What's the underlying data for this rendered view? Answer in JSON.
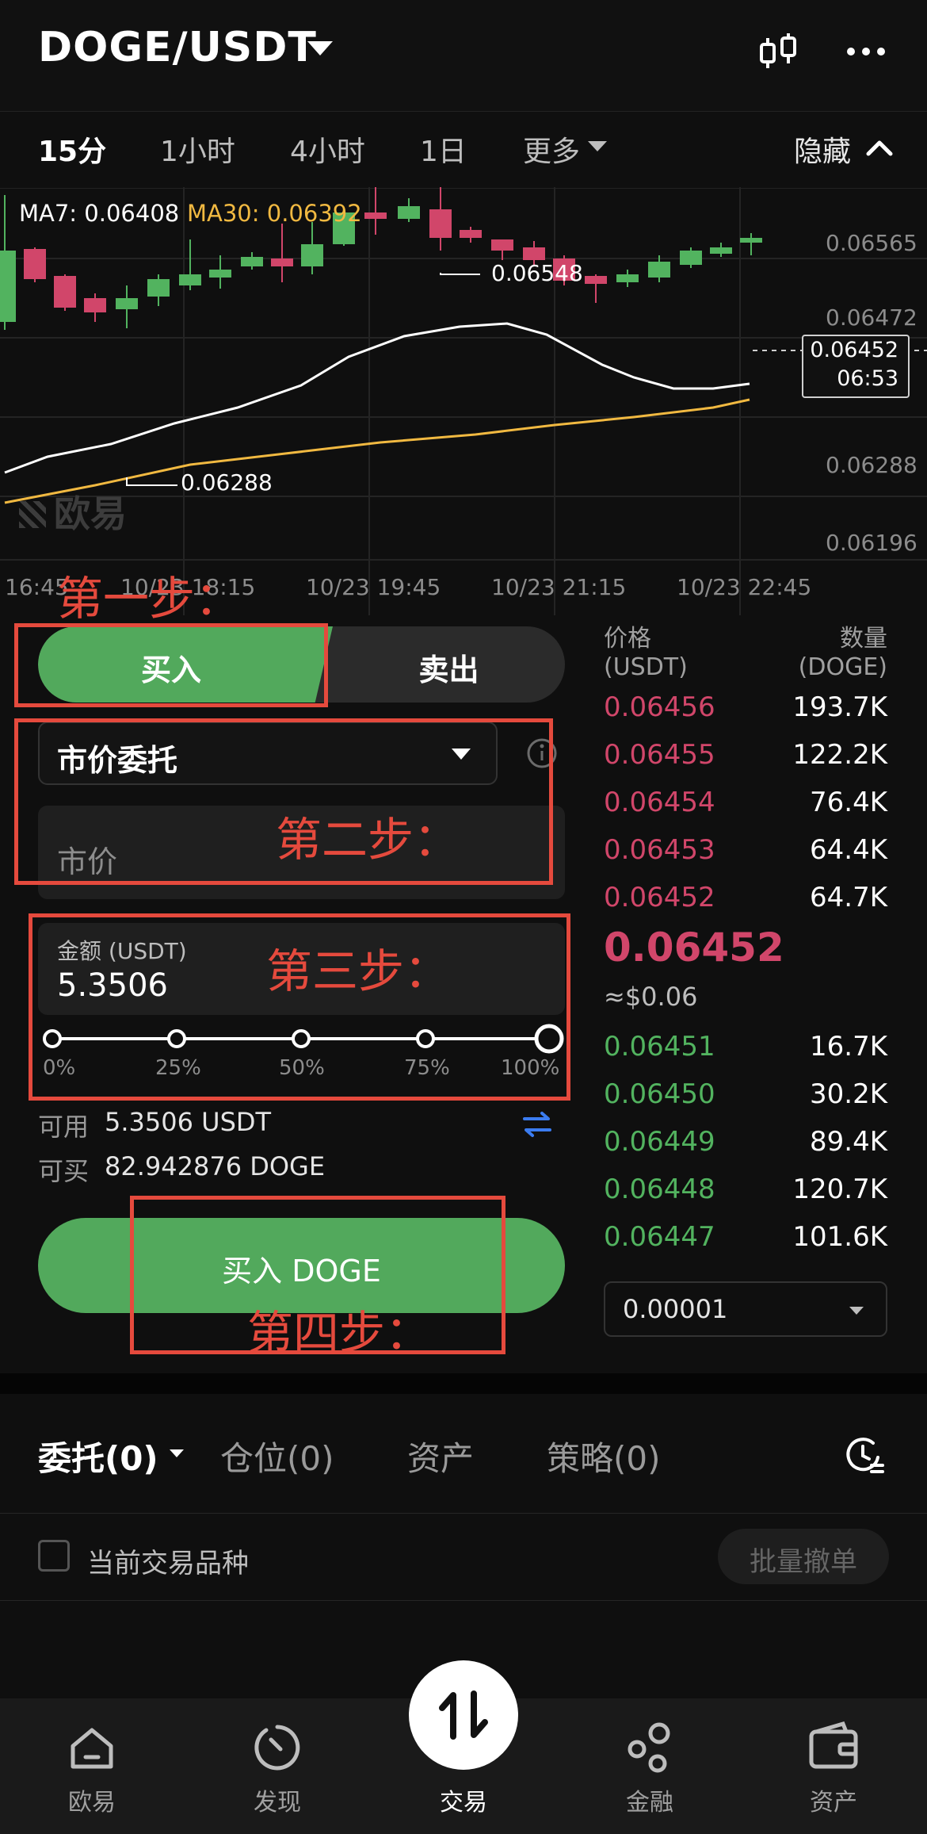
{
  "header": {
    "pair": "DOGE/USDT",
    "icons": [
      "candlestick-icon",
      "more-icon"
    ]
  },
  "timeframes": {
    "items": [
      "15分",
      "1小时",
      "4小时",
      "1日",
      "更多"
    ],
    "active": "15分",
    "hide_label": "隐藏"
  },
  "chart": {
    "ma7": "MA7: 0.06408",
    "ma30": "MA30: 0.06392",
    "y_ticks": [
      "0.06565",
      "0.06472",
      "0.06288",
      "0.06196"
    ],
    "x_ticks": [
      "16:45",
      "10/23 18:15",
      "10/23 19:45",
      "10/23 21:15",
      "10/23 22:45"
    ],
    "high_label": "0.06548",
    "low_label": "0.06288",
    "current_price": "0.06452",
    "countdown": "06:53",
    "watermark": "欧易",
    "colors": {
      "up": "#52b35f",
      "down": "#d1466a",
      "ma7": "#ffffff",
      "ma30": "#f1b941"
    }
  },
  "order_form": {
    "buy_tab": "买入",
    "sell_tab": "卖出",
    "order_type": "市价委托",
    "market_price_placeholder": "市价",
    "amount_label": "金额 (USDT)",
    "amount_value": "5.3506",
    "slider_marks": [
      "0%",
      "25%",
      "50%",
      "75%",
      "100%"
    ],
    "slider_value_pct": 100,
    "available_label": "可用",
    "available_value": "5.3506 USDT",
    "can_buy_label": "可买",
    "can_buy_value": "82.942876 DOGE",
    "buy_button": "买入 DOGE"
  },
  "order_book": {
    "price_header": "价格\n(USDT)",
    "qty_header": "数量\n(DOGE)",
    "asks": [
      {
        "price": "0.06456",
        "qty": "193.7K"
      },
      {
        "price": "0.06455",
        "qty": "122.2K"
      },
      {
        "price": "0.06454",
        "qty": "76.4K"
      },
      {
        "price": "0.06453",
        "qty": "64.4K"
      },
      {
        "price": "0.06452",
        "qty": "64.7K"
      }
    ],
    "last_price": "0.06452",
    "last_price_usd": "≈$0.06",
    "bids": [
      {
        "price": "0.06451",
        "qty": "16.7K"
      },
      {
        "price": "0.06450",
        "qty": "30.2K"
      },
      {
        "price": "0.06449",
        "qty": "89.4K"
      },
      {
        "price": "0.06448",
        "qty": "120.7K"
      },
      {
        "price": "0.06447",
        "qty": "101.6K"
      }
    ],
    "precision": "0.00001"
  },
  "bottom_tabs": {
    "items": [
      "委托(0)",
      "仓位(0)",
      "资产",
      "策略(0)"
    ],
    "filter_label": "当前交易品种",
    "cancel_all": "批量撤单"
  },
  "nav": {
    "items": [
      "欧易",
      "发现",
      "交易",
      "金融",
      "资产"
    ],
    "active": "交易"
  },
  "annotations": {
    "step1": "第一步：",
    "step2": "第二步：",
    "step3": "第三步：",
    "step4": "第四步：",
    "color": "#e54a3d"
  }
}
